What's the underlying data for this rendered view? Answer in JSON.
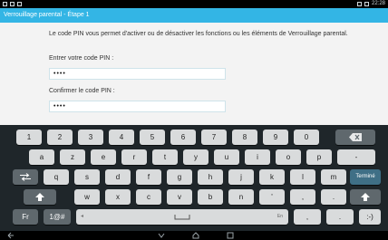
{
  "status": {
    "time": "22:28"
  },
  "title": "Verrouillage parental - Étape 1",
  "description": "Le code PIN vous permet d'activer ou de désactiver les fonctions ou les éléments de Verrouillage parental.",
  "entry_label": "Entrer votre code PIN :",
  "entry_value": "••••",
  "confirm_label": "Confirmer le code PIN :",
  "confirm_value": "••••",
  "keyboard": {
    "row1": [
      "1",
      "2",
      "3",
      "4",
      "5",
      "6",
      "7",
      "8",
      "9",
      "0"
    ],
    "row2": [
      "a",
      "z",
      "e",
      "r",
      "t",
      "y",
      "u",
      "i",
      "o",
      "p",
      "-"
    ],
    "row3": [
      "q",
      "s",
      "d",
      "f",
      "g",
      "h",
      "j",
      "k",
      "l",
      "m"
    ],
    "row4": [
      "w",
      "x",
      "c",
      "v",
      "b",
      "n",
      "'",
      ",",
      "."
    ],
    "done_label": "Terminé",
    "lang_label": "Fr",
    "symbols_label": "1@#",
    "space_lang": "En",
    "comma": ",",
    "period": ".",
    "smiley": ":-)"
  },
  "icons": {
    "backspace": "backspace-icon",
    "tab": "tab-icon",
    "shift": "shift-icon",
    "space": "space-icon",
    "back": "back-icon",
    "home": "home-icon",
    "recents": "recents-icon"
  }
}
